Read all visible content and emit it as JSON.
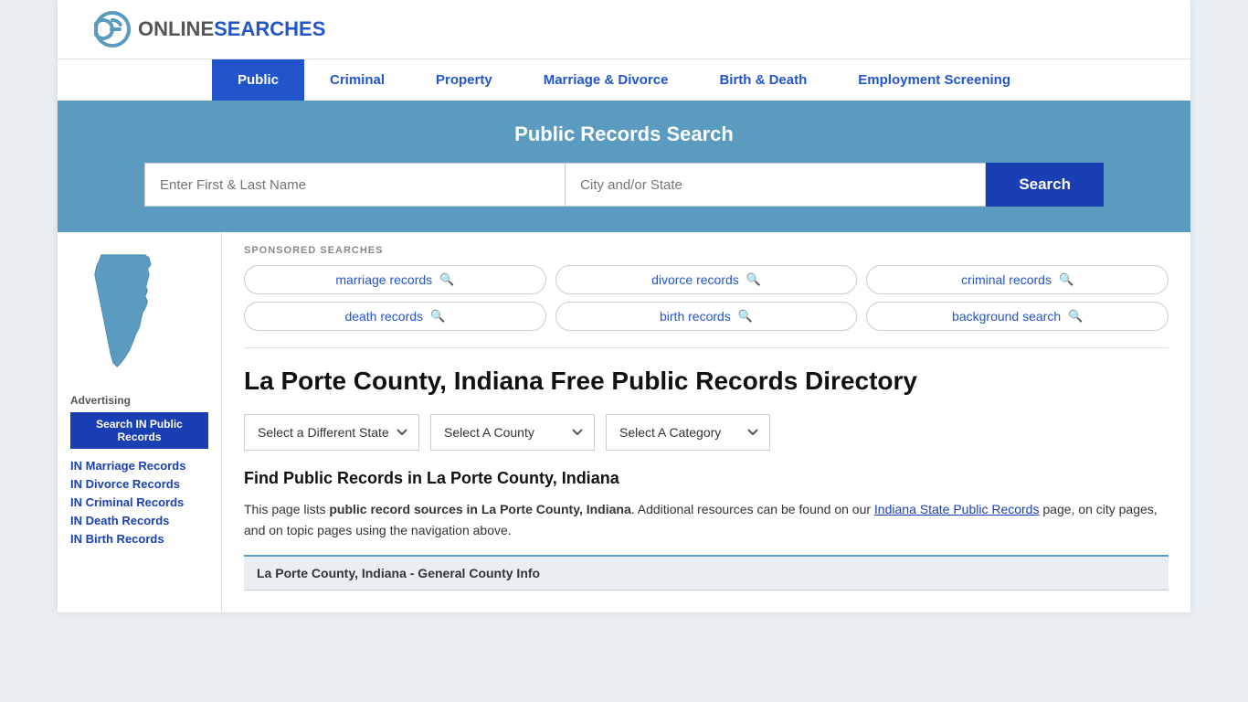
{
  "site": {
    "logo_online": "ONLINE",
    "logo_searches": "SEARCHES"
  },
  "nav": {
    "items": [
      {
        "label": "Public",
        "active": true
      },
      {
        "label": "Criminal",
        "active": false
      },
      {
        "label": "Property",
        "active": false
      },
      {
        "label": "Marriage & Divorce",
        "active": false
      },
      {
        "label": "Birth & Death",
        "active": false
      },
      {
        "label": "Employment Screening",
        "active": false
      }
    ]
  },
  "search_banner": {
    "title": "Public Records Search",
    "name_placeholder": "Enter First & Last Name",
    "location_placeholder": "City and/or State",
    "button_label": "Search"
  },
  "sponsored": {
    "label": "SPONSORED SEARCHES",
    "tags": [
      {
        "label": "marriage records"
      },
      {
        "label": "divorce records"
      },
      {
        "label": "criminal records"
      },
      {
        "label": "death records"
      },
      {
        "label": "birth records"
      },
      {
        "label": "background search"
      }
    ]
  },
  "page": {
    "title": "La Porte County, Indiana Free Public Records Directory",
    "dropdowns": {
      "state": "Select a Different State",
      "county": "Select A County",
      "category": "Select A Category"
    },
    "find_title": "Find Public Records in La Porte County, Indiana",
    "find_text_1": "This page lists ",
    "find_text_bold": "public record sources in La Porte County, Indiana",
    "find_text_2": ". Additional resources can be found on our ",
    "find_link": "Indiana State Public Records",
    "find_text_3": " page, on city pages, and on topic pages using the navigation above.",
    "county_info_label": "La Porte County, Indiana - General County Info"
  },
  "sidebar": {
    "ad_label": "Advertising",
    "ad_button": "Search IN Public Records",
    "links": [
      {
        "label": "IN Marriage Records"
      },
      {
        "label": "IN Divorce Records"
      },
      {
        "label": "IN Criminal Records"
      },
      {
        "label": "IN Death Records"
      },
      {
        "label": "IN Birth Records"
      }
    ]
  }
}
